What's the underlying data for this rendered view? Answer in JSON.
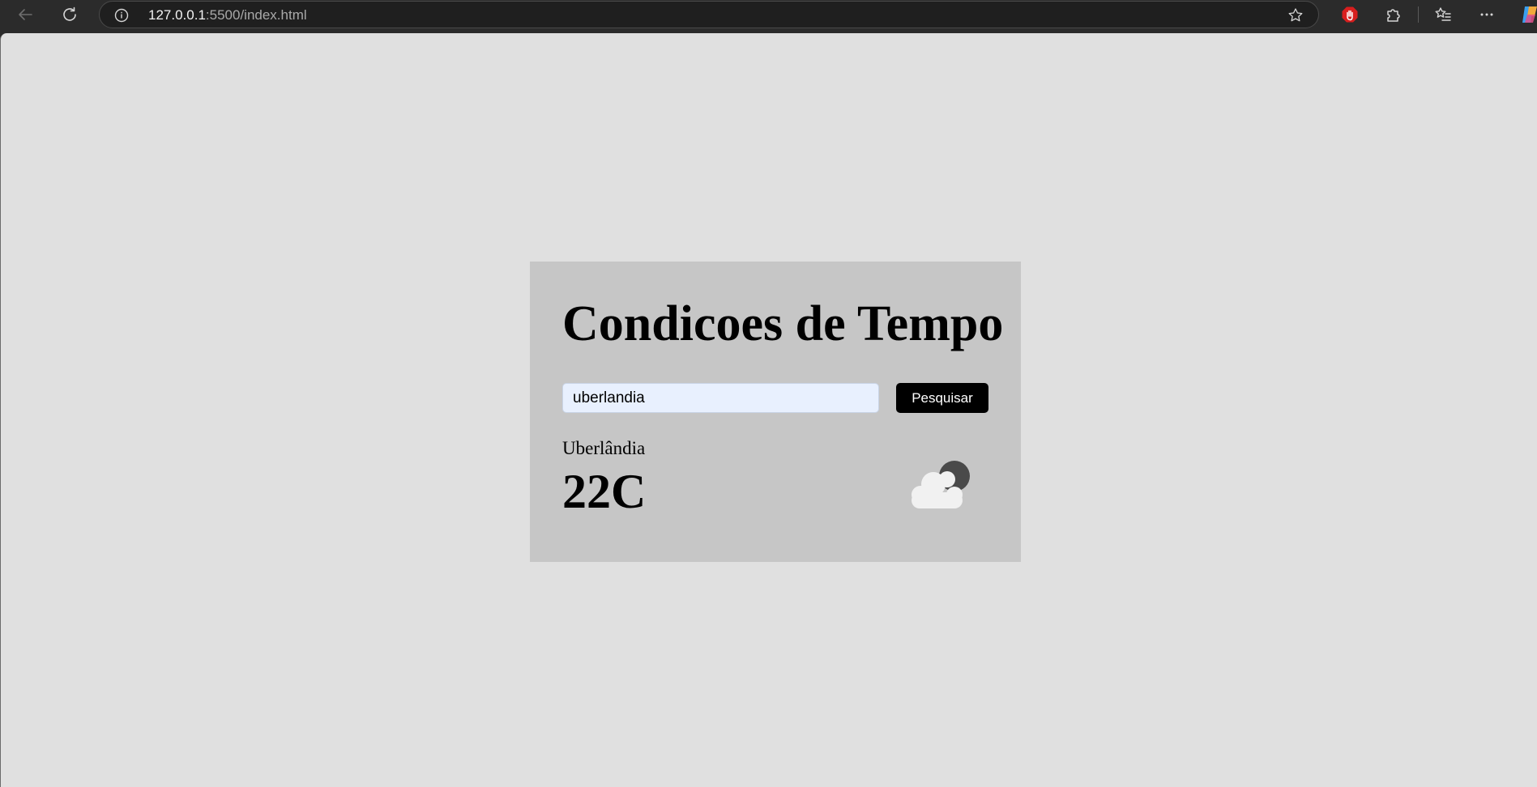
{
  "browser": {
    "url_host": "127.0.0.1",
    "url_rest": ":5500/index.html"
  },
  "app": {
    "title": "Condicoes de Tempo",
    "search": {
      "value": "uberlandia",
      "button_label": "Pesquisar"
    },
    "weather": {
      "city": "Uberlândia",
      "temperature": "22C",
      "icon": "cloud-night-icon"
    }
  },
  "colors": {
    "page_background": "#e0e0e0",
    "card_background": "#c6c6c6",
    "button_background": "#000000",
    "input_background": "#e8f0fe"
  }
}
